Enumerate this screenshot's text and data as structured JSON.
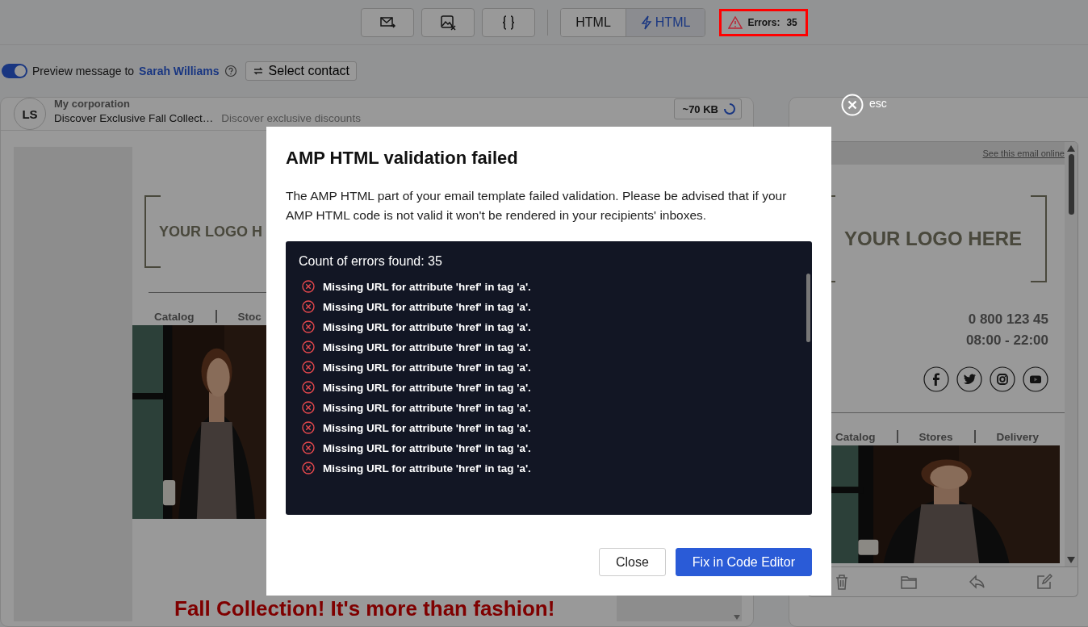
{
  "format_tabs": [
    {
      "label": "HTML",
      "kind": "plain",
      "selected": false
    },
    {
      "label": "HTML",
      "kind": "amp",
      "selected": true
    }
  ],
  "errors_badge": {
    "label": "Errors:",
    "count": "35"
  },
  "preview": {
    "on": true,
    "label": "Preview message to",
    "contact": "Sarah Williams",
    "button": "Select contact"
  },
  "message": {
    "avatar": "LS",
    "sender": "My corporation",
    "subject": "Discover Exclusive Fall Collect…",
    "preheader": "Discover exclusive discounts",
    "size": "~70 KB"
  },
  "email_left": {
    "logo": "YOUR LOGO H",
    "nav": [
      "Catalog",
      "Stoc"
    ],
    "headline": "Fall Collection! It's more than fashion!"
  },
  "email_right": {
    "online_link": "See this email online",
    "logo": "YOUR LOGO HERE",
    "phone": "0 800 123 45",
    "hours": "08:00 - 22:00",
    "nav": [
      "Catalog",
      "Stores",
      "Delivery"
    ]
  },
  "close_hint": "esc",
  "dialog": {
    "title": "AMP HTML validation failed",
    "text": "The AMP HTML part of your email template failed validation. Please be advised that if your AMP HTML code is not valid it won't be rendered in your recipients' inboxes.",
    "errors_title": "Count of errors found: 35",
    "errors": [
      "Missing URL for attribute 'href' in tag 'a'.",
      "Missing URL for attribute 'href' in tag 'a'.",
      "Missing URL for attribute 'href' in tag 'a'.",
      "Missing URL for attribute 'href' in tag 'a'.",
      "Missing URL for attribute 'href' in tag 'a'.",
      "Missing URL for attribute 'href' in tag 'a'.",
      "Missing URL for attribute 'href' in tag 'a'.",
      "Missing URL for attribute 'href' in tag 'a'.",
      "Missing URL for attribute 'href' in tag 'a'.",
      "Missing URL for attribute 'href' in tag 'a'."
    ],
    "buttons": [
      {
        "label": "Close",
        "kind": "secondary"
      },
      {
        "label": "Fix in Code Editor",
        "kind": "primary"
      }
    ]
  }
}
